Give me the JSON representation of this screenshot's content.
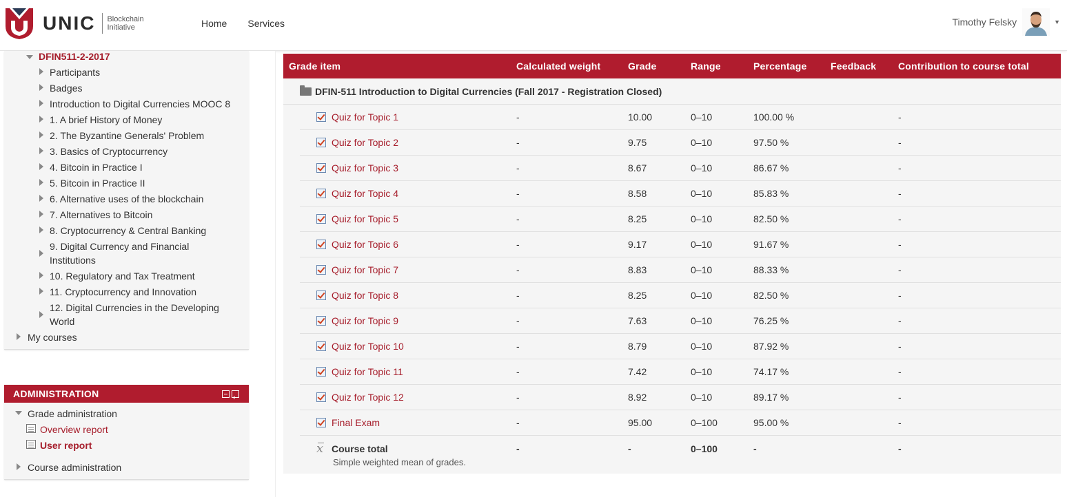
{
  "header": {
    "logo_text": "UNIC",
    "logo_sub_1": "Blockchain",
    "logo_sub_2": "Initiative",
    "nav": [
      "Home",
      "Services"
    ],
    "user_name": "Timothy Felsky"
  },
  "nav_tree": {
    "course": "DFIN511-2-2017",
    "items": [
      "Participants",
      "Badges",
      "Introduction to Digital Currencies MOOC 8",
      "1. A brief History of Money",
      "2. The Byzantine Generals' Problem",
      "3. Basics of Cryptocurrency",
      "4. Bitcoin in Practice I",
      "5. Bitcoin in Practice II",
      "6. Alternative uses of the blockchain",
      "7. Alternatives to Bitcoin",
      "8. Cryptocurrency & Central Banking",
      "9. Digital Currency and Financial Institutions",
      "10. Regulatory and Tax Treatment",
      "11. Cryptocurrency and Innovation",
      "12. Digital Currencies in the Developing World"
    ],
    "item9_line1": "9. Digital Currency and Financial",
    "item9_line2": "Institutions",
    "item12_line1": "12. Digital Currencies in the Developing",
    "item12_line2": "World",
    "my_courses": "My courses"
  },
  "admin": {
    "title": "ADMINISTRATION",
    "grade_admin": "Grade administration",
    "overview_report": "Overview report",
    "user_report": "User report",
    "course_admin": "Course administration"
  },
  "grades": {
    "columns": [
      "Grade item",
      "Calculated weight",
      "Grade",
      "Range",
      "Percentage",
      "Feedback",
      "Contribution to course total"
    ],
    "category": "DFIN-511 Introduction to Digital Currencies (Fall 2017 - Registration Closed)",
    "rows": [
      {
        "item": "Quiz for Topic 1",
        "weight": "-",
        "grade": "10.00",
        "range": "0–10",
        "percentage": "100.00 %",
        "feedback": "",
        "contribution": "-"
      },
      {
        "item": "Quiz for Topic 2",
        "weight": "-",
        "grade": "9.75",
        "range": "0–10",
        "percentage": "97.50 %",
        "feedback": "",
        "contribution": "-"
      },
      {
        "item": "Quiz for Topic 3",
        "weight": "-",
        "grade": "8.67",
        "range": "0–10",
        "percentage": "86.67 %",
        "feedback": "",
        "contribution": "-"
      },
      {
        "item": "Quiz for Topic 4",
        "weight": "-",
        "grade": "8.58",
        "range": "0–10",
        "percentage": "85.83 %",
        "feedback": "",
        "contribution": "-"
      },
      {
        "item": "Quiz for Topic 5",
        "weight": "-",
        "grade": "8.25",
        "range": "0–10",
        "percentage": "82.50 %",
        "feedback": "",
        "contribution": "-"
      },
      {
        "item": "Quiz for Topic 6",
        "weight": "-",
        "grade": "9.17",
        "range": "0–10",
        "percentage": "91.67 %",
        "feedback": "",
        "contribution": "-"
      },
      {
        "item": "Quiz for Topic 7",
        "weight": "-",
        "grade": "8.83",
        "range": "0–10",
        "percentage": "88.33 %",
        "feedback": "",
        "contribution": "-"
      },
      {
        "item": "Quiz for Topic 8",
        "weight": "-",
        "grade": "8.25",
        "range": "0–10",
        "percentage": "82.50 %",
        "feedback": "",
        "contribution": "-"
      },
      {
        "item": "Quiz for Topic 9",
        "weight": "-",
        "grade": "7.63",
        "range": "0–10",
        "percentage": "76.25 %",
        "feedback": "",
        "contribution": "-"
      },
      {
        "item": "Quiz for Topic 10",
        "weight": "-",
        "grade": "8.79",
        "range": "0–10",
        "percentage": "87.92 %",
        "feedback": "",
        "contribution": "-"
      },
      {
        "item": "Quiz for Topic 11",
        "weight": "-",
        "grade": "7.42",
        "range": "0–10",
        "percentage": "74.17 %",
        "feedback": "",
        "contribution": "-"
      },
      {
        "item": "Quiz for Topic 12",
        "weight": "-",
        "grade": "8.92",
        "range": "0–10",
        "percentage": "89.17 %",
        "feedback": "",
        "contribution": "-"
      },
      {
        "item": "Final Exam",
        "weight": "-",
        "grade": "95.00",
        "range": "0–100",
        "percentage": "95.00 %",
        "feedback": "",
        "contribution": "-"
      }
    ],
    "total": {
      "label": "Course total",
      "sub": "Simple weighted mean of grades.",
      "weight": "-",
      "grade": "-",
      "range": "0–100",
      "percentage": "-",
      "contribution": "-"
    }
  },
  "colors": {
    "brand_red": "#b01c2e",
    "link_red": "#a61d2b"
  }
}
